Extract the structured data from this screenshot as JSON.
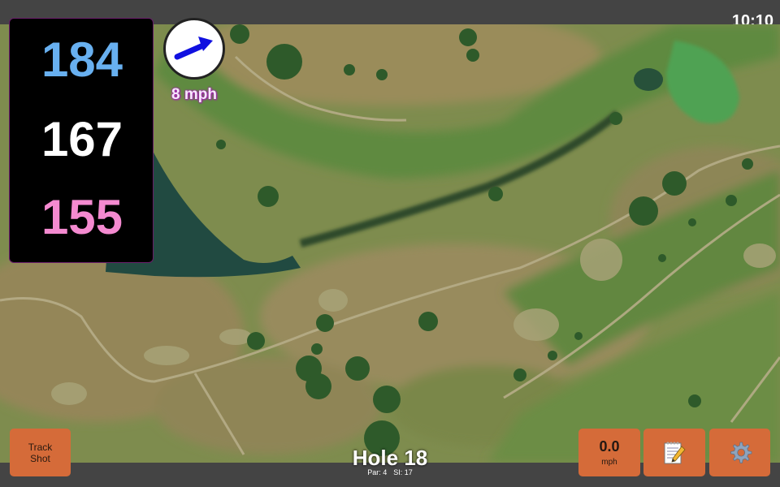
{
  "status": {
    "time": "10:10"
  },
  "yardages": {
    "back": "184",
    "middle": "167",
    "front": "155"
  },
  "wind": {
    "speed": "8 mph",
    "icon": "wind-arrow-icon"
  },
  "hole": {
    "title": "Hole 18",
    "par": "Par: 4",
    "si": "SI: 17"
  },
  "buttons": {
    "track_shot": "Track Shot",
    "speed_value": "0.0",
    "speed_unit": "mph",
    "notes_icon": "notepad-icon",
    "settings_icon": "gear-icon"
  },
  "colors": {
    "back_yardage": "#68b0f0",
    "middle_yardage": "#ffffff",
    "front_yardage": "#f48ad0",
    "button": "#d56b39",
    "wind_arrow": "#1010e0"
  }
}
